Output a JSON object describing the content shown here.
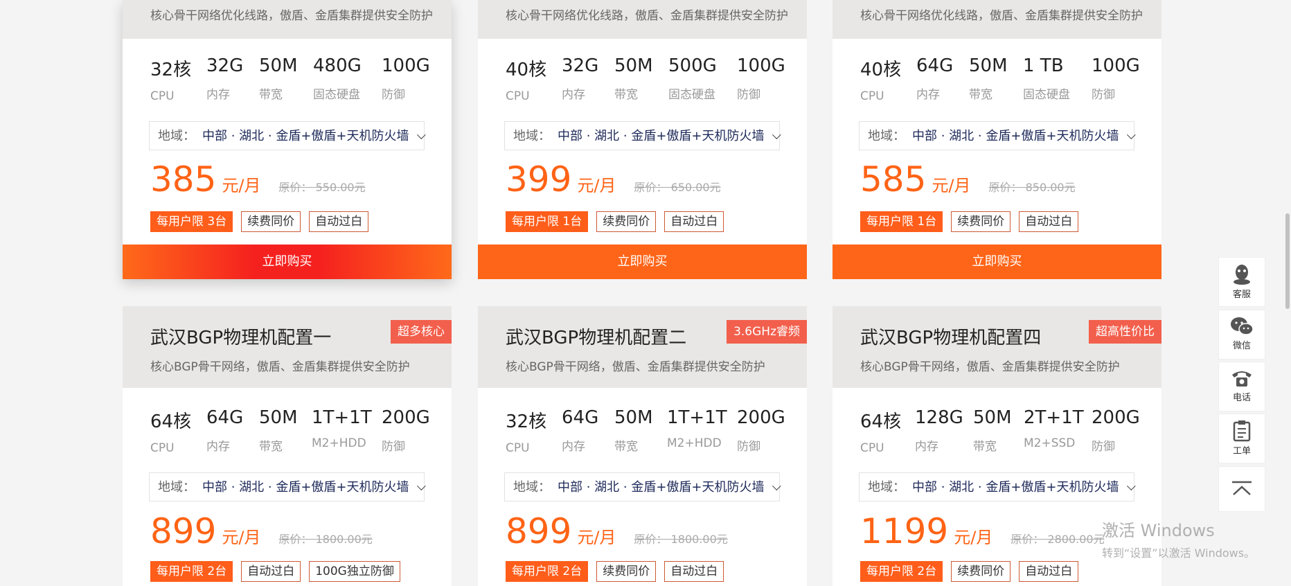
{
  "colors": {
    "accent": "#ff6315",
    "badge": "#f25f4c",
    "buy": "#ff6518"
  },
  "cards_top": [
    {
      "subtitle": "核心骨干网络优化线路，傲盾、金盾集群提供安全防护",
      "specs": [
        {
          "value": "32核",
          "label": "CPU"
        },
        {
          "value": "32G",
          "label": "内存"
        },
        {
          "value": "50M",
          "label": "带宽"
        },
        {
          "value": "480G",
          "label": "固态硬盘"
        },
        {
          "value": "100G",
          "label": "防御"
        }
      ],
      "region_key": "地域：",
      "region_value": "中部 · 湖北 · 金盾+傲盾+天机防火墙",
      "price": "385",
      "unit": "元/月",
      "original": "原价：  550.00元",
      "tags": [
        "每用户限 3台",
        "续费同价",
        "自动过白"
      ],
      "buy": "立即购买"
    },
    {
      "subtitle": "核心骨干网络优化线路，傲盾、金盾集群提供安全防护",
      "specs": [
        {
          "value": "40核",
          "label": "CPU"
        },
        {
          "value": "32G",
          "label": "内存"
        },
        {
          "value": "50M",
          "label": "带宽"
        },
        {
          "value": "500G",
          "label": "固态硬盘"
        },
        {
          "value": "100G",
          "label": "防御"
        }
      ],
      "region_key": "地域：",
      "region_value": "中部 · 湖北 · 金盾+傲盾+天机防火墙",
      "price": "399",
      "unit": "元/月",
      "original": "原价：  650.00元",
      "tags": [
        "每用户限 1台",
        "续费同价",
        "自动过白"
      ],
      "buy": "立即购买"
    },
    {
      "subtitle": "核心骨干网络优化线路，傲盾、金盾集群提供安全防护",
      "specs": [
        {
          "value": "40核",
          "label": "CPU"
        },
        {
          "value": "64G",
          "label": "内存"
        },
        {
          "value": "50M",
          "label": "带宽"
        },
        {
          "value": "1 TB",
          "label": "固态硬盘"
        },
        {
          "value": "100G",
          "label": "防御"
        }
      ],
      "region_key": "地域：",
      "region_value": "中部 · 湖北 · 金盾+傲盾+天机防火墙",
      "price": "585",
      "unit": "元/月",
      "original": "原价：  850.00元",
      "tags": [
        "每用户限 1台",
        "续费同价",
        "自动过白"
      ],
      "buy": "立即购买"
    }
  ],
  "cards_bottom": [
    {
      "title": "武汉BGP物理机配置一",
      "badge": "超多核心",
      "subtitle": "核心BGP骨干网络，傲盾、金盾集群提供安全防护",
      "specs": [
        {
          "value": "64核",
          "label": "CPU"
        },
        {
          "value": "64G",
          "label": "内存"
        },
        {
          "value": "50M",
          "label": "带宽"
        },
        {
          "value": "1T+1T",
          "label": "M2+HDD"
        },
        {
          "value": "200G",
          "label": "防御"
        }
      ],
      "region_key": "地域：",
      "region_value": "中部 · 湖北 · 金盾+傲盾+天机防火墙",
      "price": "899",
      "unit": "元/月",
      "original": "原价：  1800.00元",
      "tags": [
        "每用户限 2台",
        "自动过白",
        "100G独立防御"
      ]
    },
    {
      "title": "武汉BGP物理机配置二",
      "badge": "3.6GHz睿频",
      "subtitle": "核心BGP骨干网络，傲盾、金盾集群提供安全防护",
      "specs": [
        {
          "value": "32核",
          "label": "CPU"
        },
        {
          "value": "64G",
          "label": "内存"
        },
        {
          "value": "50M",
          "label": "带宽"
        },
        {
          "value": "1T+1T",
          "label": "M2+HDD"
        },
        {
          "value": "200G",
          "label": "防御"
        }
      ],
      "region_key": "地域：",
      "region_value": "中部 · 湖北 · 金盾+傲盾+天机防火墙",
      "price": "899",
      "unit": "元/月",
      "original": "原价：  1800.00元",
      "tags": [
        "每用户限 2台",
        "续费同价",
        "自动过白"
      ]
    },
    {
      "title": "武汉BGP物理机配置四",
      "badge": "超高性价比",
      "subtitle": "核心BGP骨干网络，傲盾、金盾集群提供安全防护",
      "specs": [
        {
          "value": "64核",
          "label": "CPU"
        },
        {
          "value": "128G",
          "label": "内存"
        },
        {
          "value": "50M",
          "label": "带宽"
        },
        {
          "value": "2T+1T",
          "label": "M2+SSD"
        },
        {
          "value": "200G",
          "label": "防御"
        }
      ],
      "region_key": "地域：",
      "region_value": "中部 · 湖北 · 金盾+傲盾+天机防火墙",
      "price": "1199",
      "unit": "元/月",
      "original": "原价：  2800.00元",
      "tags": [
        "每用户限 2台",
        "续费同价",
        "自动过白"
      ]
    }
  ],
  "sidebar": [
    {
      "label": "客服",
      "icon": "qq-icon"
    },
    {
      "label": "微信",
      "icon": "wechat-icon"
    },
    {
      "label": "电话",
      "icon": "phone-icon"
    },
    {
      "label": "工单",
      "icon": "ticket-icon"
    },
    {
      "label": "",
      "icon": "back-to-top-icon"
    }
  ],
  "watermark": {
    "line1": "激活 Windows",
    "line2": "转到“设置”以激活 Windows。"
  }
}
